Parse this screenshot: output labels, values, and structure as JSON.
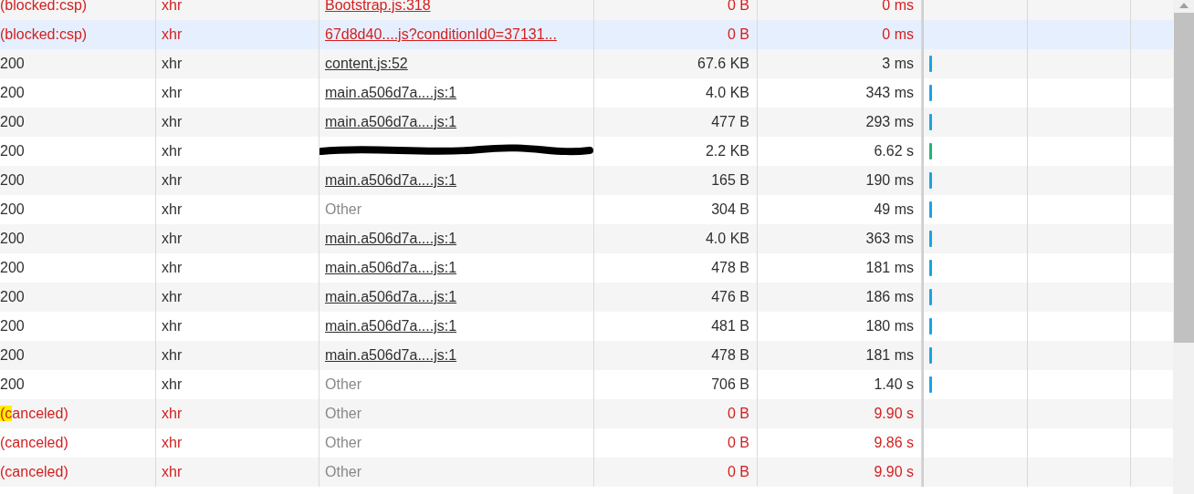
{
  "rows": [
    {
      "status": "(blocked:csp)",
      "type": "xhr",
      "initiator": "Bootstrap.js:318",
      "kind": "link",
      "size": "0 B",
      "time": "0 ms",
      "failed": true,
      "selected": false,
      "search_match": false
    },
    {
      "status": "(blocked:csp)",
      "type": "xhr",
      "initiator": "67d8d40....js?conditionId0=37131...",
      "kind": "link",
      "size": "0 B",
      "time": "0 ms",
      "failed": true,
      "selected": true,
      "search_match": false
    },
    {
      "status": "200",
      "type": "xhr",
      "initiator": "content.js:52",
      "kind": "link",
      "size": "67.6 KB",
      "time": "3 ms",
      "failed": false,
      "selected": false,
      "search_match": false,
      "color": "#1aa5e0"
    },
    {
      "status": "200",
      "type": "xhr",
      "initiator": "main.a506d7a....js:1",
      "kind": "link",
      "size": "4.0 KB",
      "time": "343 ms",
      "failed": false,
      "selected": false,
      "search_match": false,
      "color": "#1aa5e0"
    },
    {
      "status": "200",
      "type": "xhr",
      "initiator": "main.a506d7a....js:1",
      "kind": "link",
      "size": "477 B",
      "time": "293 ms",
      "failed": false,
      "selected": false,
      "search_match": false,
      "color": "#1aa5e0"
    },
    {
      "status": "200",
      "type": "xhr",
      "kind": "redacted",
      "size": "2.2 KB",
      "time": "6.62 s",
      "failed": false,
      "selected": false,
      "search_match": false,
      "color": "#22b573"
    },
    {
      "status": "200",
      "type": "xhr",
      "initiator": "main.a506d7a....js:1",
      "kind": "link",
      "size": "165 B",
      "time": "190 ms",
      "failed": false,
      "selected": false,
      "search_match": false,
      "color": "#1aa5e0"
    },
    {
      "status": "200",
      "type": "xhr",
      "initiator": "Other",
      "kind": "other",
      "size": "304 B",
      "time": "49 ms",
      "failed": false,
      "selected": false,
      "search_match": false,
      "color": "#1aa5e0"
    },
    {
      "status": "200",
      "type": "xhr",
      "initiator": "main.a506d7a....js:1",
      "kind": "link",
      "size": "4.0 KB",
      "time": "363 ms",
      "failed": false,
      "selected": false,
      "search_match": false,
      "color": "#1aa5e0"
    },
    {
      "status": "200",
      "type": "xhr",
      "initiator": "main.a506d7a....js:1",
      "kind": "link",
      "size": "478 B",
      "time": "181 ms",
      "failed": false,
      "selected": false,
      "search_match": false,
      "color": "#1aa5e0"
    },
    {
      "status": "200",
      "type": "xhr",
      "initiator": "main.a506d7a....js:1",
      "kind": "link",
      "size": "476 B",
      "time": "186 ms",
      "failed": false,
      "selected": false,
      "search_match": false,
      "color": "#1aa5e0"
    },
    {
      "status": "200",
      "type": "xhr",
      "initiator": "main.a506d7a....js:1",
      "kind": "link",
      "size": "481 B",
      "time": "180 ms",
      "failed": false,
      "selected": false,
      "search_match": false,
      "color": "#1aa5e0"
    },
    {
      "status": "200",
      "type": "xhr",
      "initiator": "main.a506d7a....js:1",
      "kind": "link",
      "size": "478 B",
      "time": "181 ms",
      "failed": false,
      "selected": false,
      "search_match": false,
      "color": "#1aa5e0"
    },
    {
      "status": "200",
      "type": "xhr",
      "initiator": "Other",
      "kind": "other",
      "size": "706 B",
      "time": "1.40 s",
      "failed": false,
      "selected": false,
      "search_match": false,
      "color": "#1aa5e0"
    },
    {
      "status": "(canceled)",
      "type": "xhr",
      "initiator": "Other",
      "kind": "other",
      "size": "0 B",
      "time": "9.90 s",
      "failed": true,
      "selected": false,
      "search_match": true
    },
    {
      "status": "(canceled)",
      "type": "xhr",
      "initiator": "Other",
      "kind": "other",
      "size": "0 B",
      "time": "9.86 s",
      "failed": true,
      "selected": false,
      "search_match": false
    },
    {
      "status": "(canceled)",
      "type": "xhr",
      "initiator": "Other",
      "kind": "other",
      "size": "0 B",
      "time": "9.90 s",
      "failed": true,
      "selected": false,
      "search_match": false
    }
  ]
}
